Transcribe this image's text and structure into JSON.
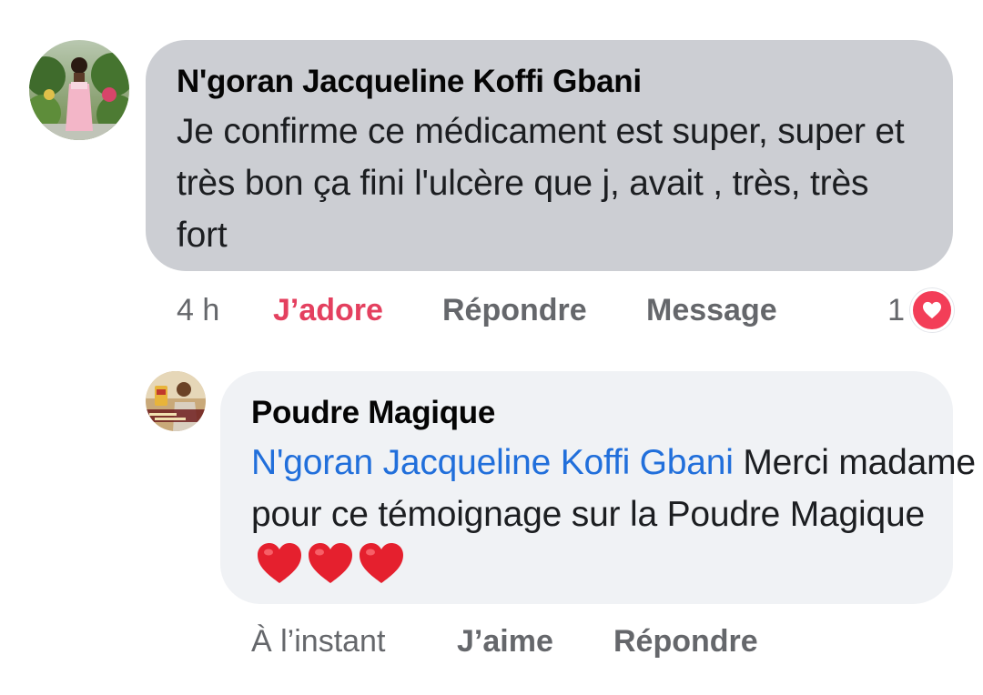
{
  "comment": {
    "author": "N'goran Jacqueline Koffi Gbani",
    "text": "Je confirme ce médicament est super, super et très bon ça fini l'ulcère  que j, avait , très, très fort",
    "time": "4 h",
    "love_label": "J’adore",
    "reply_label": "Répondre",
    "message_label": "Message",
    "reaction_count": "1",
    "reaction_icon": "heart-reaction-icon",
    "colors": {
      "bubble": "#ccced3",
      "love": "#e4405f",
      "meta": "#65676b"
    }
  },
  "reply": {
    "author": "Poudre Magique",
    "mention": "N'goran Jacqueline Koffi Gbani",
    "text": " Merci madame pour ce témoignage sur la Poudre Magique ",
    "emoji": "red-heart-emoji",
    "emoji_count": 3,
    "time": "À l’instant",
    "like_label": "J’aime",
    "reply_label": "Répondre",
    "colors": {
      "bubble": "#f0f2f5",
      "mention": "#216fdb"
    }
  }
}
